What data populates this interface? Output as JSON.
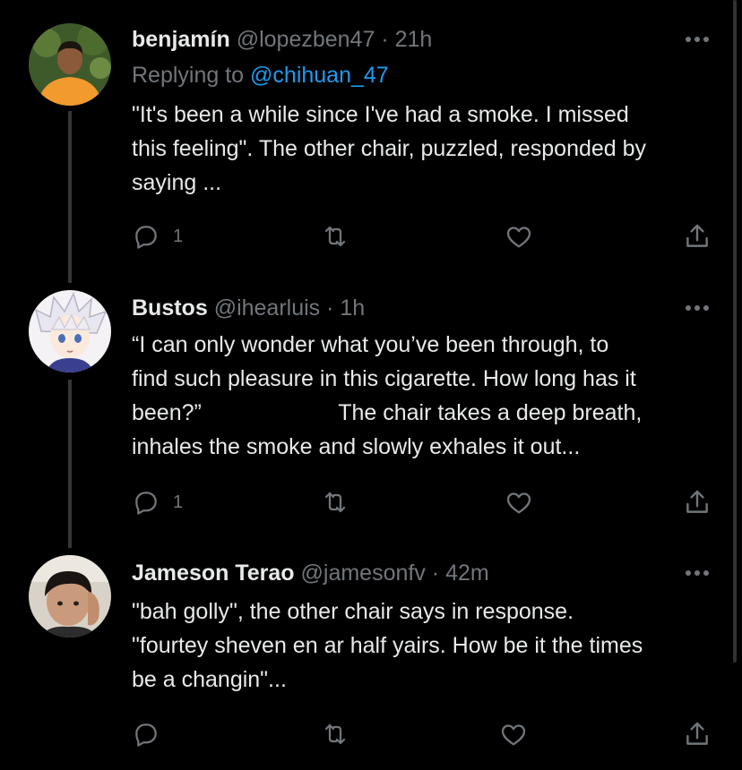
{
  "tweets": [
    {
      "name": "benjamín",
      "handle": "@lopezben47",
      "separator": "·",
      "time": "21h",
      "replying_prefix": "Replying to",
      "replying_to": "@chihuan_47",
      "text": "\"It's been a while since I've had a smoke. I missed\nthis feeling\". The other chair, puzzled, responded by\nsaying ...",
      "reply_count": "1",
      "avatar_icon": "avatar-photo-orange-shirt"
    },
    {
      "name": "Bustos",
      "handle": "@ihearluis",
      "separator": "·",
      "time": "1h",
      "text": "“I can only wonder what you’ve been through, to\nfind such pleasure in this cigarette. How long has it\nbeen?”                      The chair takes a deep breath,\ninhales the smoke and slowly exhales it out...",
      "reply_count": "1",
      "avatar_icon": "avatar-anime-white-hair"
    },
    {
      "name": "Jameson Terao",
      "handle": "@jamesonfv",
      "separator": "·",
      "time": "42m",
      "text": "\"bah golly\", the other chair says in response.\n\"fourtey sheven en ar half yairs. How be it the times\nbe a changin\"...",
      "reply_count": "",
      "avatar_icon": "avatar-photo-selfie"
    }
  ],
  "icons": {
    "more": "more-horizontal-icon",
    "reply": "reply-icon",
    "retweet": "retweet-icon",
    "like": "heart-icon",
    "share": "share-icon"
  },
  "colors": {
    "background": "#000000",
    "text": "#e7e9ea",
    "secondary": "#71767b",
    "link": "#1d9bf0",
    "thread_line": "#333639"
  }
}
